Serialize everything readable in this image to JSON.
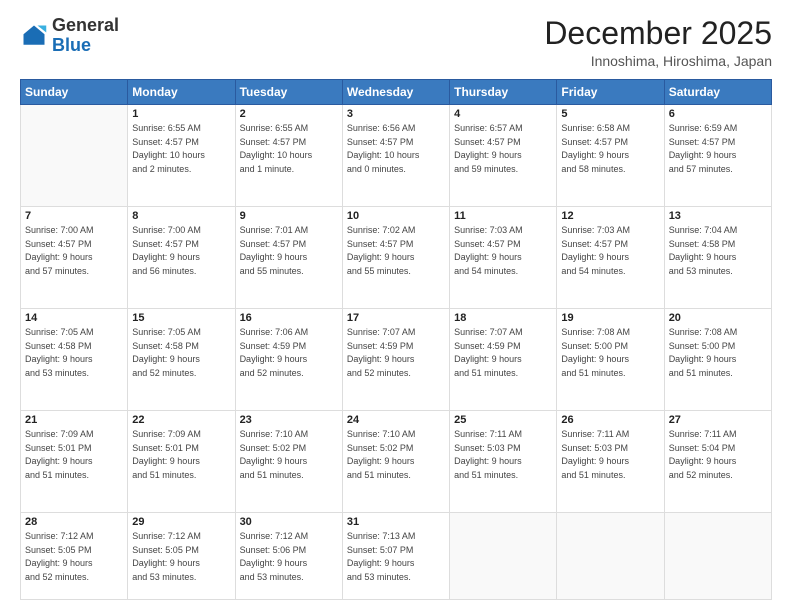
{
  "header": {
    "logo_general": "General",
    "logo_blue": "Blue",
    "month_title": "December 2025",
    "location": "Innoshima, Hiroshima, Japan"
  },
  "weekdays": [
    "Sunday",
    "Monday",
    "Tuesday",
    "Wednesday",
    "Thursday",
    "Friday",
    "Saturday"
  ],
  "weeks": [
    [
      {
        "day": "",
        "info": ""
      },
      {
        "day": "1",
        "info": "Sunrise: 6:55 AM\nSunset: 4:57 PM\nDaylight: 10 hours\nand 2 minutes."
      },
      {
        "day": "2",
        "info": "Sunrise: 6:55 AM\nSunset: 4:57 PM\nDaylight: 10 hours\nand 1 minute."
      },
      {
        "day": "3",
        "info": "Sunrise: 6:56 AM\nSunset: 4:57 PM\nDaylight: 10 hours\nand 0 minutes."
      },
      {
        "day": "4",
        "info": "Sunrise: 6:57 AM\nSunset: 4:57 PM\nDaylight: 9 hours\nand 59 minutes."
      },
      {
        "day": "5",
        "info": "Sunrise: 6:58 AM\nSunset: 4:57 PM\nDaylight: 9 hours\nand 58 minutes."
      },
      {
        "day": "6",
        "info": "Sunrise: 6:59 AM\nSunset: 4:57 PM\nDaylight: 9 hours\nand 57 minutes."
      }
    ],
    [
      {
        "day": "7",
        "info": "Sunrise: 7:00 AM\nSunset: 4:57 PM\nDaylight: 9 hours\nand 57 minutes."
      },
      {
        "day": "8",
        "info": "Sunrise: 7:00 AM\nSunset: 4:57 PM\nDaylight: 9 hours\nand 56 minutes."
      },
      {
        "day": "9",
        "info": "Sunrise: 7:01 AM\nSunset: 4:57 PM\nDaylight: 9 hours\nand 55 minutes."
      },
      {
        "day": "10",
        "info": "Sunrise: 7:02 AM\nSunset: 4:57 PM\nDaylight: 9 hours\nand 55 minutes."
      },
      {
        "day": "11",
        "info": "Sunrise: 7:03 AM\nSunset: 4:57 PM\nDaylight: 9 hours\nand 54 minutes."
      },
      {
        "day": "12",
        "info": "Sunrise: 7:03 AM\nSunset: 4:57 PM\nDaylight: 9 hours\nand 54 minutes."
      },
      {
        "day": "13",
        "info": "Sunrise: 7:04 AM\nSunset: 4:58 PM\nDaylight: 9 hours\nand 53 minutes."
      }
    ],
    [
      {
        "day": "14",
        "info": "Sunrise: 7:05 AM\nSunset: 4:58 PM\nDaylight: 9 hours\nand 53 minutes."
      },
      {
        "day": "15",
        "info": "Sunrise: 7:05 AM\nSunset: 4:58 PM\nDaylight: 9 hours\nand 52 minutes."
      },
      {
        "day": "16",
        "info": "Sunrise: 7:06 AM\nSunset: 4:59 PM\nDaylight: 9 hours\nand 52 minutes."
      },
      {
        "day": "17",
        "info": "Sunrise: 7:07 AM\nSunset: 4:59 PM\nDaylight: 9 hours\nand 52 minutes."
      },
      {
        "day": "18",
        "info": "Sunrise: 7:07 AM\nSunset: 4:59 PM\nDaylight: 9 hours\nand 51 minutes."
      },
      {
        "day": "19",
        "info": "Sunrise: 7:08 AM\nSunset: 5:00 PM\nDaylight: 9 hours\nand 51 minutes."
      },
      {
        "day": "20",
        "info": "Sunrise: 7:08 AM\nSunset: 5:00 PM\nDaylight: 9 hours\nand 51 minutes."
      }
    ],
    [
      {
        "day": "21",
        "info": "Sunrise: 7:09 AM\nSunset: 5:01 PM\nDaylight: 9 hours\nand 51 minutes."
      },
      {
        "day": "22",
        "info": "Sunrise: 7:09 AM\nSunset: 5:01 PM\nDaylight: 9 hours\nand 51 minutes."
      },
      {
        "day": "23",
        "info": "Sunrise: 7:10 AM\nSunset: 5:02 PM\nDaylight: 9 hours\nand 51 minutes."
      },
      {
        "day": "24",
        "info": "Sunrise: 7:10 AM\nSunset: 5:02 PM\nDaylight: 9 hours\nand 51 minutes."
      },
      {
        "day": "25",
        "info": "Sunrise: 7:11 AM\nSunset: 5:03 PM\nDaylight: 9 hours\nand 51 minutes."
      },
      {
        "day": "26",
        "info": "Sunrise: 7:11 AM\nSunset: 5:03 PM\nDaylight: 9 hours\nand 51 minutes."
      },
      {
        "day": "27",
        "info": "Sunrise: 7:11 AM\nSunset: 5:04 PM\nDaylight: 9 hours\nand 52 minutes."
      }
    ],
    [
      {
        "day": "28",
        "info": "Sunrise: 7:12 AM\nSunset: 5:05 PM\nDaylight: 9 hours\nand 52 minutes."
      },
      {
        "day": "29",
        "info": "Sunrise: 7:12 AM\nSunset: 5:05 PM\nDaylight: 9 hours\nand 53 minutes."
      },
      {
        "day": "30",
        "info": "Sunrise: 7:12 AM\nSunset: 5:06 PM\nDaylight: 9 hours\nand 53 minutes."
      },
      {
        "day": "31",
        "info": "Sunrise: 7:13 AM\nSunset: 5:07 PM\nDaylight: 9 hours\nand 53 minutes."
      },
      {
        "day": "",
        "info": ""
      },
      {
        "day": "",
        "info": ""
      },
      {
        "day": "",
        "info": ""
      }
    ]
  ]
}
